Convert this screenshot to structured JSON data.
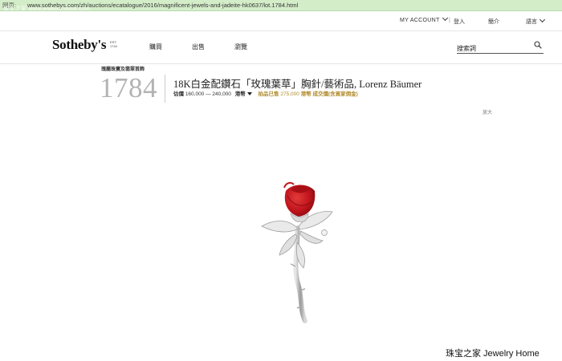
{
  "browser": {
    "url_prefix": "网页:",
    "url": "www.sothebys.com/zh/auctions/ecatalogue/2016/magnificent-jewels-and-jadeite-hk0637/lot.1784.html",
    "watermark_overlay": "珠宝之家 www.jewelryhome.com"
  },
  "utility_bar": {
    "account": "MY ACCOUNT",
    "separator": "|",
    "login": "登入",
    "about": "簡介",
    "language": "語言"
  },
  "header": {
    "logo": "Sotheby's",
    "logo_tag": "EST. 1744",
    "nav": {
      "buy": "購買",
      "sell": "出售",
      "browse": "瀏覽"
    },
    "search_placeholder": "搜索詞"
  },
  "lot": {
    "sale_title": "瑰麗珠寶及翡翠首飾",
    "number": "1784",
    "title": "18K白金配鑽石「玫瑰葉草」胸針/藝術品, Lorenz Bäumer",
    "estimate_label": "估價",
    "estimate_value": "160,000 — 240,000",
    "currency": "港幣",
    "sold_label": "拍品已售",
    "sold_value": "275,000",
    "sold_currency": "港幣",
    "sold_note": "成交價(含買家佣金)",
    "zoom": "放大"
  },
  "image": {
    "icon": "rose-brooch-image"
  },
  "watermark": "珠宝之家  Jewelry Home"
}
